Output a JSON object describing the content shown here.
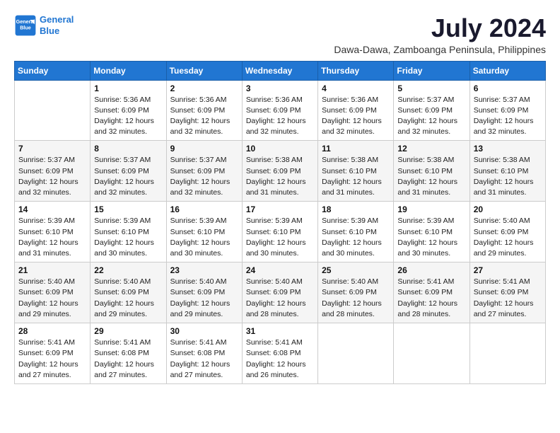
{
  "logo": {
    "line1": "General",
    "line2": "Blue"
  },
  "title": "July 2024",
  "subtitle": "Dawa-Dawa, Zamboanga Peninsula, Philippines",
  "days_header": [
    "Sunday",
    "Monday",
    "Tuesday",
    "Wednesday",
    "Thursday",
    "Friday",
    "Saturday"
  ],
  "weeks": [
    [
      {
        "day": "",
        "info": ""
      },
      {
        "day": "1",
        "info": "Sunrise: 5:36 AM\nSunset: 6:09 PM\nDaylight: 12 hours\nand 32 minutes."
      },
      {
        "day": "2",
        "info": "Sunrise: 5:36 AM\nSunset: 6:09 PM\nDaylight: 12 hours\nand 32 minutes."
      },
      {
        "day": "3",
        "info": "Sunrise: 5:36 AM\nSunset: 6:09 PM\nDaylight: 12 hours\nand 32 minutes."
      },
      {
        "day": "4",
        "info": "Sunrise: 5:36 AM\nSunset: 6:09 PM\nDaylight: 12 hours\nand 32 minutes."
      },
      {
        "day": "5",
        "info": "Sunrise: 5:37 AM\nSunset: 6:09 PM\nDaylight: 12 hours\nand 32 minutes."
      },
      {
        "day": "6",
        "info": "Sunrise: 5:37 AM\nSunset: 6:09 PM\nDaylight: 12 hours\nand 32 minutes."
      }
    ],
    [
      {
        "day": "7",
        "info": "Sunrise: 5:37 AM\nSunset: 6:09 PM\nDaylight: 12 hours\nand 32 minutes."
      },
      {
        "day": "8",
        "info": "Sunrise: 5:37 AM\nSunset: 6:09 PM\nDaylight: 12 hours\nand 32 minutes."
      },
      {
        "day": "9",
        "info": "Sunrise: 5:37 AM\nSunset: 6:09 PM\nDaylight: 12 hours\nand 32 minutes."
      },
      {
        "day": "10",
        "info": "Sunrise: 5:38 AM\nSunset: 6:09 PM\nDaylight: 12 hours\nand 31 minutes."
      },
      {
        "day": "11",
        "info": "Sunrise: 5:38 AM\nSunset: 6:10 PM\nDaylight: 12 hours\nand 31 minutes."
      },
      {
        "day": "12",
        "info": "Sunrise: 5:38 AM\nSunset: 6:10 PM\nDaylight: 12 hours\nand 31 minutes."
      },
      {
        "day": "13",
        "info": "Sunrise: 5:38 AM\nSunset: 6:10 PM\nDaylight: 12 hours\nand 31 minutes."
      }
    ],
    [
      {
        "day": "14",
        "info": "Sunrise: 5:39 AM\nSunset: 6:10 PM\nDaylight: 12 hours\nand 31 minutes."
      },
      {
        "day": "15",
        "info": "Sunrise: 5:39 AM\nSunset: 6:10 PM\nDaylight: 12 hours\nand 30 minutes."
      },
      {
        "day": "16",
        "info": "Sunrise: 5:39 AM\nSunset: 6:10 PM\nDaylight: 12 hours\nand 30 minutes."
      },
      {
        "day": "17",
        "info": "Sunrise: 5:39 AM\nSunset: 6:10 PM\nDaylight: 12 hours\nand 30 minutes."
      },
      {
        "day": "18",
        "info": "Sunrise: 5:39 AM\nSunset: 6:10 PM\nDaylight: 12 hours\nand 30 minutes."
      },
      {
        "day": "19",
        "info": "Sunrise: 5:39 AM\nSunset: 6:10 PM\nDaylight: 12 hours\nand 30 minutes."
      },
      {
        "day": "20",
        "info": "Sunrise: 5:40 AM\nSunset: 6:09 PM\nDaylight: 12 hours\nand 29 minutes."
      }
    ],
    [
      {
        "day": "21",
        "info": "Sunrise: 5:40 AM\nSunset: 6:09 PM\nDaylight: 12 hours\nand 29 minutes."
      },
      {
        "day": "22",
        "info": "Sunrise: 5:40 AM\nSunset: 6:09 PM\nDaylight: 12 hours\nand 29 minutes."
      },
      {
        "day": "23",
        "info": "Sunrise: 5:40 AM\nSunset: 6:09 PM\nDaylight: 12 hours\nand 29 minutes."
      },
      {
        "day": "24",
        "info": "Sunrise: 5:40 AM\nSunset: 6:09 PM\nDaylight: 12 hours\nand 28 minutes."
      },
      {
        "day": "25",
        "info": "Sunrise: 5:40 AM\nSunset: 6:09 PM\nDaylight: 12 hours\nand 28 minutes."
      },
      {
        "day": "26",
        "info": "Sunrise: 5:41 AM\nSunset: 6:09 PM\nDaylight: 12 hours\nand 28 minutes."
      },
      {
        "day": "27",
        "info": "Sunrise: 5:41 AM\nSunset: 6:09 PM\nDaylight: 12 hours\nand 27 minutes."
      }
    ],
    [
      {
        "day": "28",
        "info": "Sunrise: 5:41 AM\nSunset: 6:09 PM\nDaylight: 12 hours\nand 27 minutes."
      },
      {
        "day": "29",
        "info": "Sunrise: 5:41 AM\nSunset: 6:08 PM\nDaylight: 12 hours\nand 27 minutes."
      },
      {
        "day": "30",
        "info": "Sunrise: 5:41 AM\nSunset: 6:08 PM\nDaylight: 12 hours\nand 27 minutes."
      },
      {
        "day": "31",
        "info": "Sunrise: 5:41 AM\nSunset: 6:08 PM\nDaylight: 12 hours\nand 26 minutes."
      },
      {
        "day": "",
        "info": ""
      },
      {
        "day": "",
        "info": ""
      },
      {
        "day": "",
        "info": ""
      }
    ]
  ]
}
